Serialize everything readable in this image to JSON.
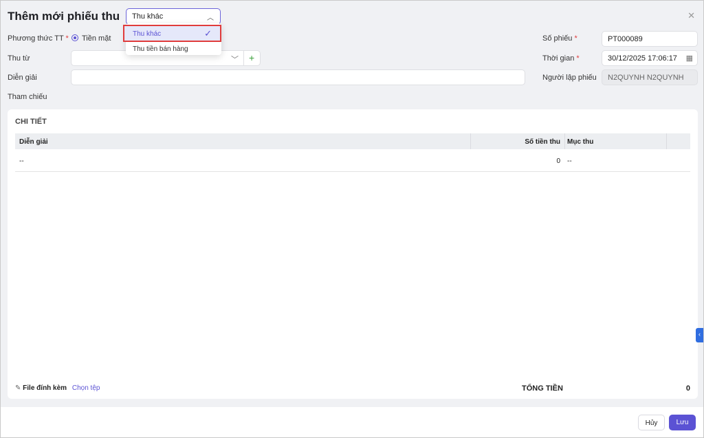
{
  "title": "Thêm mới phiếu thu",
  "type_select": {
    "value": "Thu khác",
    "options": [
      "Thu khác",
      "Thu tiền bán hàng"
    ],
    "selected": "Thu khác"
  },
  "form": {
    "payment_method_label": "Phương thức TT",
    "payment_method_value": "Tiền mặt",
    "from_label": "Thu từ",
    "from_value": "",
    "desc_label": "Diễn giải",
    "desc_value": "",
    "ref_label": "Tham chiếu",
    "number_label": "Số phiếu",
    "number_value": "PT000089",
    "time_label": "Thời gian",
    "time_value": "30/12/2025 17:06:17",
    "creator_label": "Người lập phiếu",
    "creator_value": "N2QUYNH N2QUYNH",
    "required_mark": "*"
  },
  "detail": {
    "title": "CHI TIẾT",
    "columns": [
      "Diễn giải",
      "Số tiền thu",
      "Mục thu"
    ],
    "rows": [
      [
        "--",
        "0",
        "--"
      ]
    ],
    "attach_label": "File đính kèm",
    "choose_file": "Chọn tệp",
    "total_label": "TỔNG TIỀN",
    "total_value": "0"
  },
  "buttons": {
    "cancel": "Hủy",
    "save": "Lưu"
  },
  "colors": {
    "accent": "#5b52d4",
    "highlight": "#e03b3b"
  }
}
